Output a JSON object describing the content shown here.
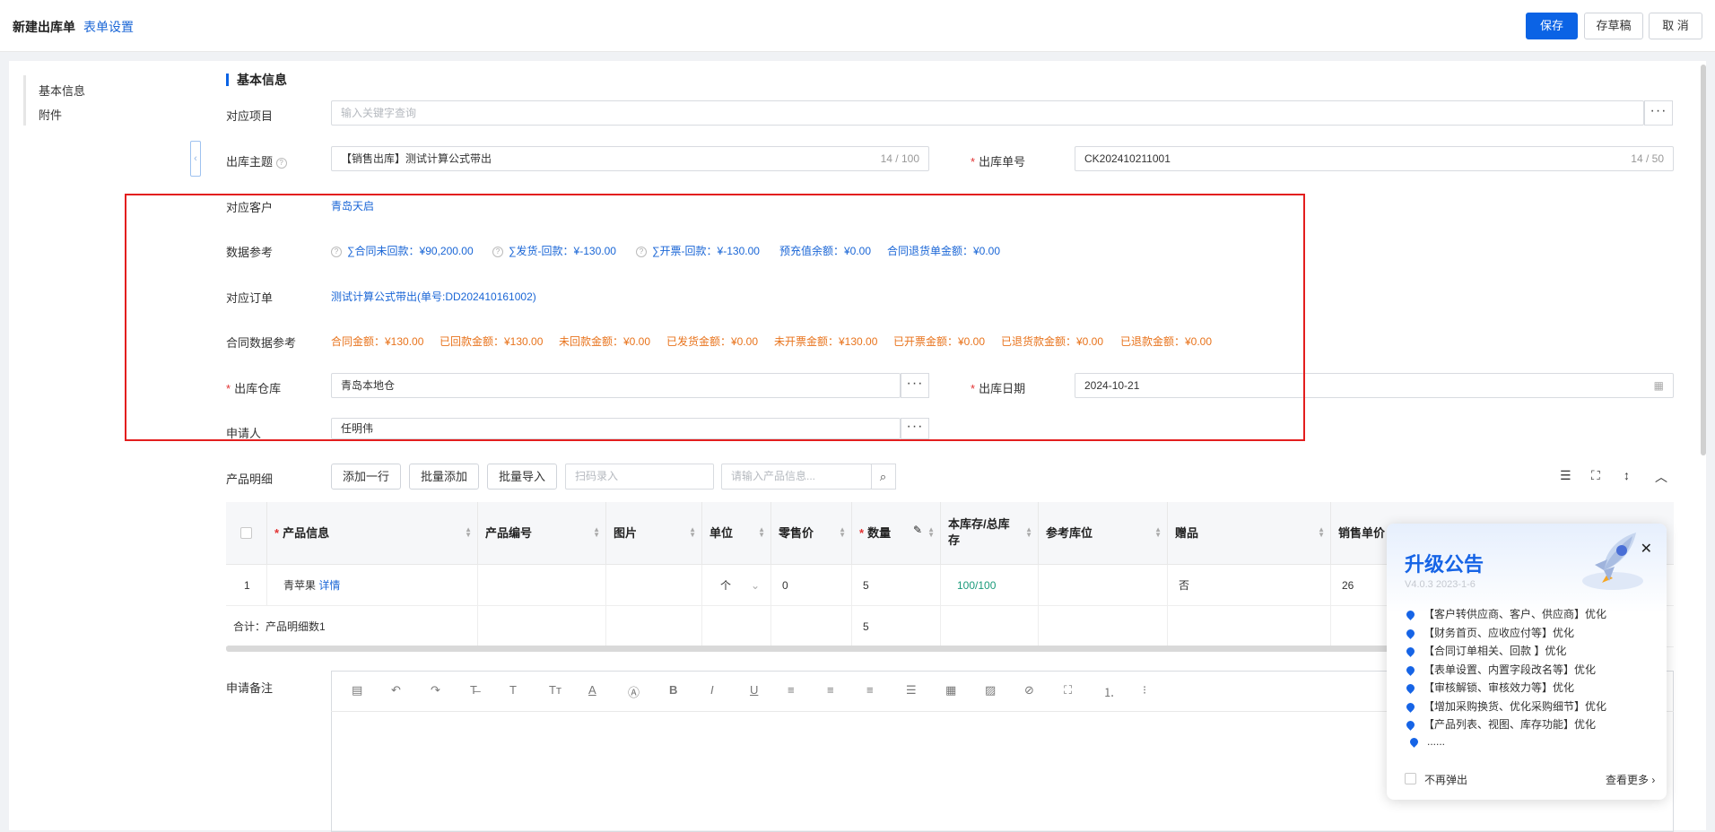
{
  "header": {
    "title": "新建出库单",
    "form_setting": "表单设置",
    "save": "保存",
    "draft": "存草稿",
    "cancel": "取 消"
  },
  "leftnav": {
    "items": [
      "基本信息",
      "附件"
    ]
  },
  "section": {
    "title": "基本信息"
  },
  "fields": {
    "project_label": "对应项目",
    "project_placeholder": "输入关键字查询",
    "subject_label": "出库主题",
    "subject_value": "【销售出库】测试计算公式带出",
    "subject_count": "14 / 100",
    "no_label": "出库单号",
    "no_value": "CK202410211001",
    "no_count": "14 / 50",
    "customer_label": "对应客户",
    "customer_value": "青岛天启",
    "dataref_label": "数据参考",
    "dataref": [
      "∑合同未回款：¥90,200.00",
      "∑发货-回款：¥-130.00",
      "∑开票-回款：¥-130.00",
      "预充值余额：¥0.00",
      "合同退货单金额：¥0.00"
    ],
    "order_label": "对应订单",
    "order_value": "测试计算公式带出(单号:DD202410161002)",
    "contract_label": "合同数据参考",
    "contract": [
      "合同金额：¥130.00",
      "已回款金额：¥130.00",
      "未回款金额：¥0.00",
      "已发货金额：¥0.00",
      "未开票金额：¥130.00",
      "已开票金额：¥0.00",
      "已退货款金额：¥0.00",
      "已退款金额：¥0.00"
    ],
    "warehouse_label": "出库仓库",
    "warehouse_value": "青岛本地仓",
    "date_label": "出库日期",
    "date_value": "2024-10-21",
    "applicant_label": "申请人",
    "applicant_value": "任明伟"
  },
  "products": {
    "label": "产品明细",
    "add_row": "添加一行",
    "batch_add": "批量添加",
    "batch_import": "批量导入",
    "scan_placeholder": "扫码录入",
    "search_placeholder": "请输入产品信息...",
    "columns": [
      "产品信息",
      "产品编号",
      "图片",
      "单位",
      "零售价",
      "数量",
      "本库存/总库存",
      "参考库位",
      "赠品",
      "销售单价"
    ],
    "row": {
      "idx": "1",
      "name": "青苹果",
      "detail": "详情",
      "unit": "个",
      "retail": "0",
      "qty": "5",
      "stock": "100",
      "total_stock": "100",
      "gift": "否",
      "price": "26"
    },
    "total_label": "合计：产品明细数1",
    "total_qty": "5"
  },
  "remark": {
    "label": "申请备注"
  },
  "popup": {
    "title": "升级公告",
    "version": "V4.0.3 2023-1-6",
    "items": [
      "【客户转供应商、客户、供应商】优化",
      "【财务首页、应收应付等】优化",
      "【合同订单相关、回款 】优化",
      "【表单设置、内置字段改名等】优化",
      "【审核解锁、审核效力等】优化",
      "【增加采购换货、优化采购细节】优化",
      "【产品列表、视图、库存功能】优化",
      "......"
    ],
    "no_popup": "不再弹出",
    "more": "查看更多"
  },
  "colors": {
    "primary": "#0b63e5",
    "link": "#1a66d6",
    "orange": "#e8731c",
    "highlight": "#e31e1e"
  }
}
